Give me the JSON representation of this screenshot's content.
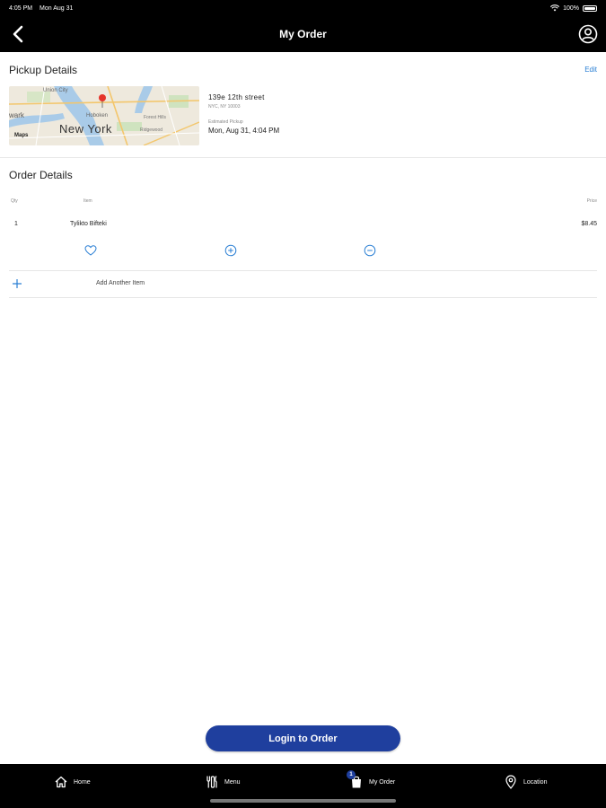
{
  "status_bar": {
    "time": "4:05 PM",
    "date": "Mon Aug 31",
    "battery": "100%"
  },
  "header": {
    "title": "My Order"
  },
  "pickup": {
    "section_title": "Pickup Details",
    "edit_label": "Edit",
    "map_labels": {
      "city1": "Union City",
      "city2": "wark",
      "city3": "Hoboken",
      "city4": "New York",
      "city5": "Ridgewood",
      "attrib": "Maps",
      "area": "Forest Hills"
    },
    "address_line1": "139e 12th  street",
    "address_line2": "NYC, NY 10003",
    "estimated_label": "Estimated Pickup",
    "estimated_time": "Mon, Aug 31, 4:04 PM"
  },
  "order": {
    "section_title": "Order Details",
    "col_qty": "Qty",
    "col_item": "Item",
    "col_price": "Price",
    "items": [
      {
        "qty": "1",
        "name": "Tylikto Bifteki",
        "price": "$8.45"
      }
    ],
    "add_label": "Add Another Item"
  },
  "login_button": "Login to Order",
  "tabs": [
    {
      "label": "Home",
      "icon": "home-icon"
    },
    {
      "label": "Menu",
      "icon": "menu-icon"
    },
    {
      "label": "My Order",
      "icon": "bag-icon",
      "badge": "1"
    },
    {
      "label": "Location",
      "icon": "location-pin-icon"
    }
  ],
  "colors": {
    "accent": "#1f3f9e",
    "link": "#2a7fd4",
    "bar": "#000000"
  }
}
